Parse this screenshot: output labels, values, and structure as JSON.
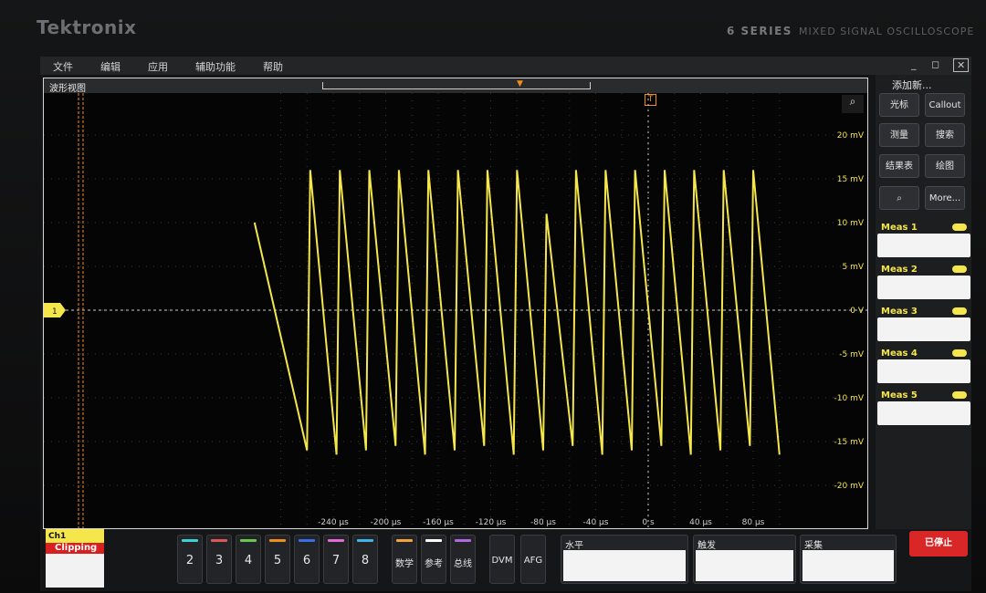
{
  "brand": "Tektronix",
  "model": "6 SERIES",
  "model_desc": "MIXED SIGNAL OSCILLOSCOPE",
  "menu": [
    {
      "label": "文件"
    },
    {
      "label": "编辑"
    },
    {
      "label": "应用"
    },
    {
      "label": "辅助功能"
    },
    {
      "label": "帮助"
    }
  ],
  "window_controls": {
    "minimize": "_",
    "restore": "◻",
    "close": "✕"
  },
  "waveform_view": {
    "title": "波形视图",
    "trigger_marker": "T",
    "trace_color": "#f4e64b",
    "position_marker_color": "#f08c1c",
    "x_ticks": [
      {
        "label": "-240 µs",
        "t": -240
      },
      {
        "label": "-200 µs",
        "t": -200
      },
      {
        "label": "-160 µs",
        "t": -160
      },
      {
        "label": "-120 µs",
        "t": -120
      },
      {
        "label": "-80 µs",
        "t": -80
      },
      {
        "label": "-40 µs",
        "t": -40
      },
      {
        "label": "0 s",
        "t": 0
      },
      {
        "label": "40 µs",
        "t": 40
      },
      {
        "label": "80 µs",
        "t": 80
      }
    ],
    "y_ticks": [
      {
        "label": "20 mV",
        "v": 20
      },
      {
        "label": "15 mV",
        "v": 15
      },
      {
        "label": "10 mV",
        "v": 10
      },
      {
        "label": "5 mV",
        "v": 5
      },
      {
        "label": "0 V",
        "v": 0
      },
      {
        "label": "-5 mV",
        "v": -5
      },
      {
        "label": "-10 mV",
        "v": -10
      },
      {
        "label": "-15 mV",
        "v": -15
      },
      {
        "label": "-20 mV",
        "v": -20
      }
    ],
    "ch_marker": "1",
    "sawtooth_period_us": 22.5,
    "sawtooth_high_mV": 16,
    "sawtooth_low_mV": -16
  },
  "right_panel": {
    "title": "添加新...",
    "buttons": [
      "光标",
      "Callout",
      "测量",
      "搜索",
      "结果表",
      "绘图",
      "",
      "More..."
    ],
    "meas": [
      "Meas 1",
      "Meas 2",
      "Meas 3",
      "Meas 4",
      "Meas 5"
    ]
  },
  "bottom": {
    "ch1_label": "Ch1",
    "clipping": "Clipping",
    "channels": [
      {
        "num": "2",
        "color": "#3ad0d4"
      },
      {
        "num": "3",
        "color": "#e05555"
      },
      {
        "num": "4",
        "color": "#6ac94a"
      },
      {
        "num": "5",
        "color": "#f08c1c"
      },
      {
        "num": "6",
        "color": "#3a6ee8"
      },
      {
        "num": "7",
        "color": "#e36ad6"
      },
      {
        "num": "8",
        "color": "#3fb6e8"
      }
    ],
    "math": {
      "label": "数学",
      "color": "#f2a33a"
    },
    "ref": {
      "label": "参考",
      "color": "#ffffff"
    },
    "bus": {
      "label": "总线",
      "color": "#b069e0"
    },
    "dvm": "DVM",
    "afg": "AFG",
    "horizontal": "水平",
    "trigger": "触发",
    "acquire": "采集",
    "stopped": "已停止"
  }
}
